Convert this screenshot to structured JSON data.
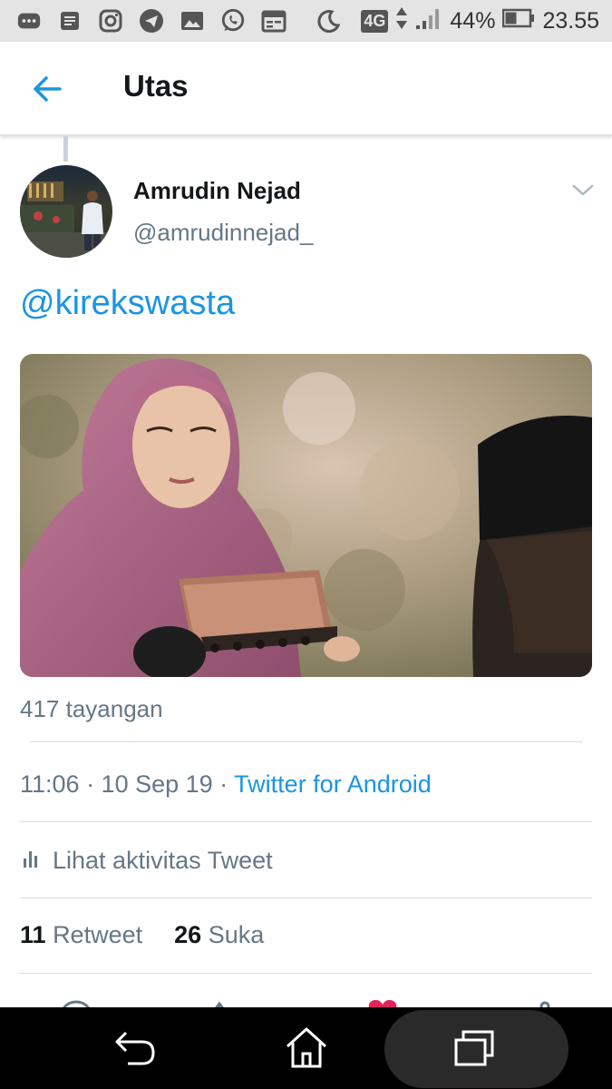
{
  "status_bar": {
    "network": "4G",
    "battery": "44%",
    "time": "23.55",
    "icons": [
      "message-icon",
      "notes-icon",
      "instagram-icon",
      "telegram-icon",
      "gallery-icon",
      "whatsapp-icon",
      "calendar-icon",
      "moon-icon",
      "signal-icon",
      "battery-icon"
    ]
  },
  "app_bar": {
    "title": "Utas",
    "back_icon": "back-arrow-icon"
  },
  "tweet": {
    "author_name": "Amrudin Nejad",
    "author_handle": "@amrudinnejad_",
    "text": "@kirekswasta",
    "views": "417 tayangan",
    "time": "11:06 · 10 Sep 19 · ",
    "source": "Twitter for Android",
    "activity_label": "Lihat aktivitas Tweet",
    "retweet_count": "11",
    "retweet_label": "Retweet",
    "like_count": "26",
    "like_label": "Suka"
  },
  "colors": {
    "accent": "#1b95e0",
    "secondary_text": "#657786",
    "primary_text": "#14171a",
    "like": "#e0245e"
  },
  "nav_bar": {
    "icons": [
      "back-icon",
      "home-icon",
      "recent-apps-icon"
    ]
  }
}
